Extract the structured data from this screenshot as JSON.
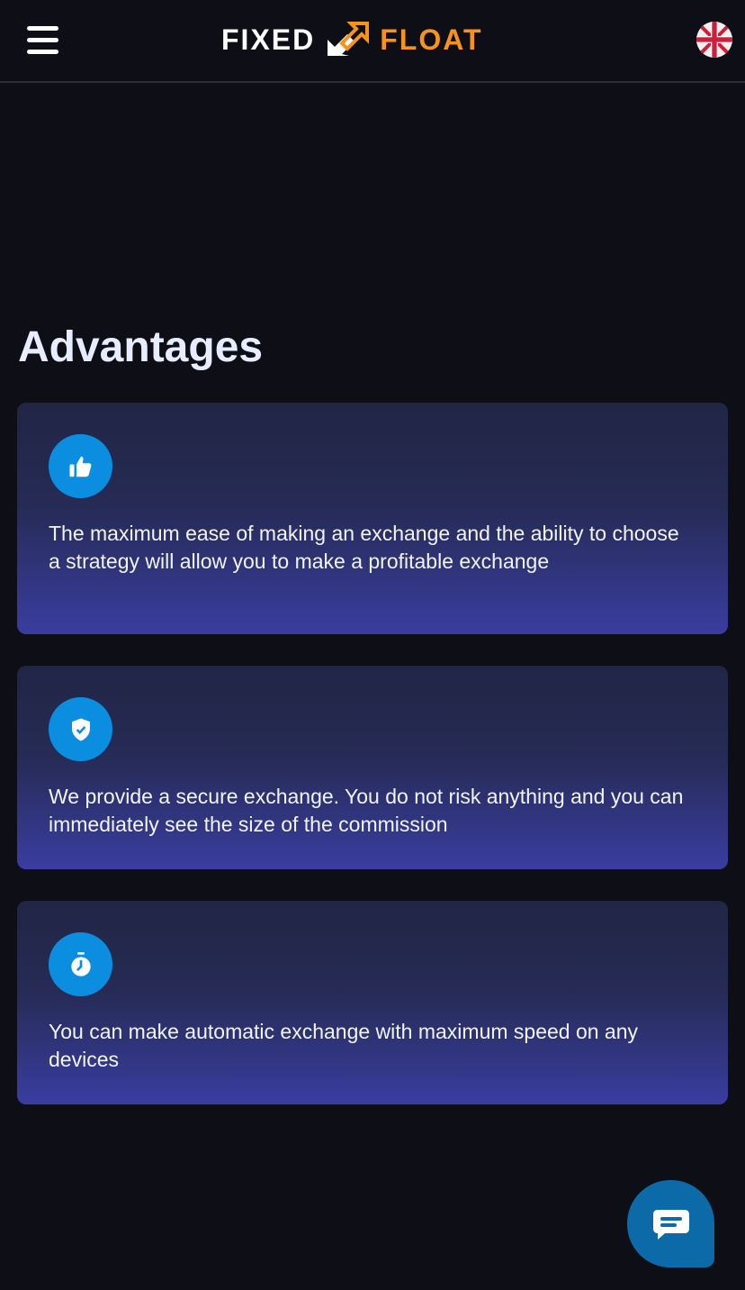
{
  "header": {
    "logo_left": "FIXED",
    "logo_right": "FLOAT",
    "menu_icon": "hamburger-menu-icon",
    "language_icon": "uk-flag-icon"
  },
  "advantages": {
    "title": "Advantages",
    "items": [
      {
        "icon": "thumbs-up-icon",
        "text": "The maximum ease of making an exchange and the ability to choose a strategy will allow you to make a profitable exchange"
      },
      {
        "icon": "shield-check-icon",
        "text": "We provide a secure exchange. You do not risk anything and you can immediately see the size of the commission"
      },
      {
        "icon": "stopwatch-icon",
        "text": "You can make automatic exchange with maximum speed on any devices"
      }
    ]
  },
  "chat": {
    "icon": "chat-bubble-icon"
  },
  "colors": {
    "background": "#0d0e16",
    "accent_orange": "#f7931a",
    "icon_blue": "#0b8ee0",
    "card_gradient_end": "#3a3da0"
  }
}
